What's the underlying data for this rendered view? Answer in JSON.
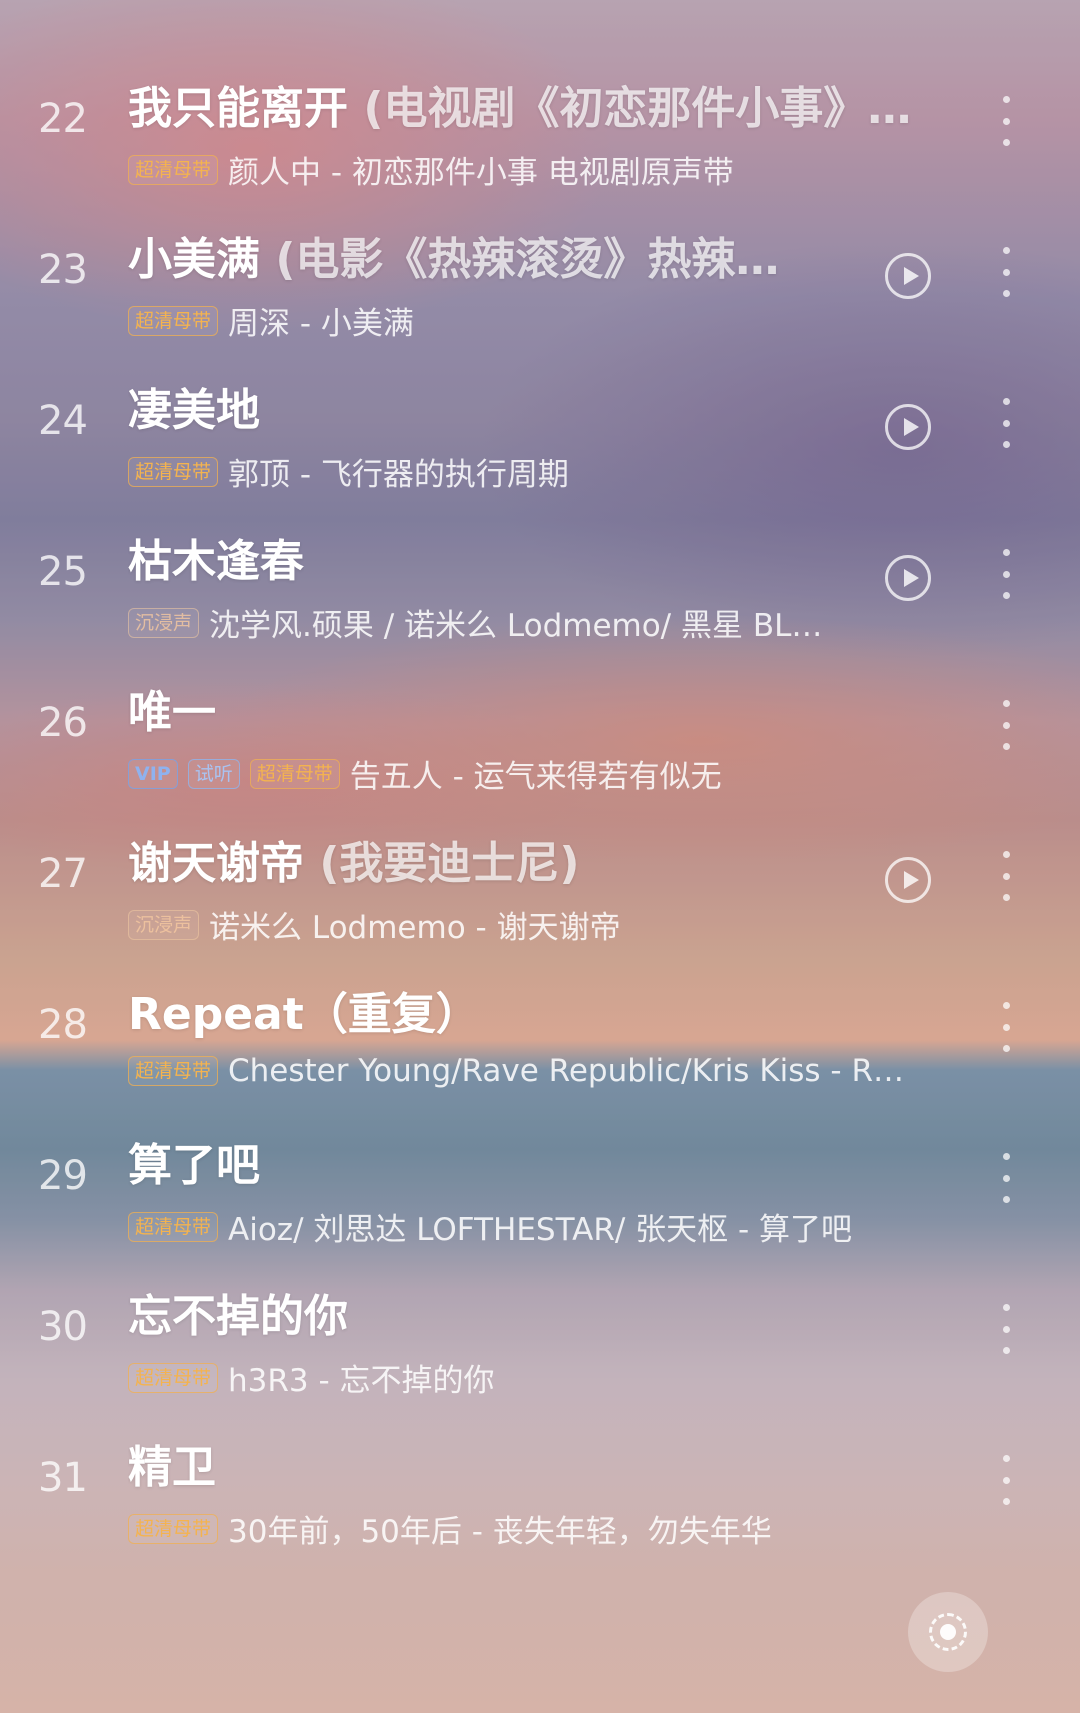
{
  "songs": [
    {
      "num": "22",
      "title": "我只能离开",
      "subtitle": " (电视剧《初恋那件小事》…",
      "tags": [
        {
          "text": "超清母带",
          "kind": "hq"
        }
      ],
      "artist": "颜人中 - 初恋那件小事 电视剧原声带",
      "has_play": false
    },
    {
      "num": "23",
      "title": "小美满",
      "subtitle": " (电影《热辣滚烫》热辣…",
      "tags": [
        {
          "text": "超清母带",
          "kind": "hq"
        }
      ],
      "artist": "周深 - 小美满",
      "has_play": true
    },
    {
      "num": "24",
      "title": "凄美地",
      "subtitle": "",
      "tags": [
        {
          "text": "超清母带",
          "kind": "hq"
        }
      ],
      "artist": "郭顶 - 飞行器的执行周期",
      "has_play": true
    },
    {
      "num": "25",
      "title": "枯木逢春",
      "subtitle": "",
      "tags": [
        {
          "text": "沉浸声",
          "kind": "dim"
        }
      ],
      "artist": "沈学风.硕果 / 诺米么 Lodmemo/ 黑星 BL…",
      "has_play": true
    },
    {
      "num": "26",
      "title": "唯一",
      "subtitle": "",
      "tags": [
        {
          "text": "VIP",
          "kind": "vip"
        },
        {
          "text": "试听",
          "kind": "try"
        },
        {
          "text": "超清母带",
          "kind": "hq"
        }
      ],
      "artist": "告五人 - 运气来得若有似无",
      "has_play": false
    },
    {
      "num": "27",
      "title": "谢天谢帝",
      "subtitle": " (我要迪士尼)",
      "tags": [
        {
          "text": "沉浸声",
          "kind": "dim"
        }
      ],
      "artist": "诺米么 Lodmemo - 谢天谢帝",
      "has_play": true
    },
    {
      "num": "28",
      "title": "Repeat（重复）",
      "subtitle": "",
      "tags": [
        {
          "text": "超清母带",
          "kind": "hq"
        }
      ],
      "artist": "Chester Young/Rave Republic/Kris Kiss - R…",
      "has_play": false
    },
    {
      "num": "29",
      "title": "算了吧",
      "subtitle": "",
      "tags": [
        {
          "text": "超清母带",
          "kind": "hq"
        }
      ],
      "artist": "Aioz/ 刘思达 LOFTHESTAR/ 张天枢 - 算了吧",
      "has_play": false
    },
    {
      "num": "30",
      "title": "忘不掉的你",
      "subtitle": "",
      "tags": [
        {
          "text": "超清母带",
          "kind": "hq"
        }
      ],
      "artist": "h3R3 - 忘不掉的你",
      "has_play": false
    },
    {
      "num": "31",
      "title": "精卫",
      "subtitle": "",
      "tags": [
        {
          "text": "超清母带",
          "kind": "hq"
        }
      ],
      "artist": "30年前，50年后 - 丧失年轻，勿失年华",
      "has_play": false
    }
  ],
  "icons": {
    "play": "play-circle-icon",
    "more": "more-vertical-icon",
    "locate": "locate-current-icon"
  }
}
